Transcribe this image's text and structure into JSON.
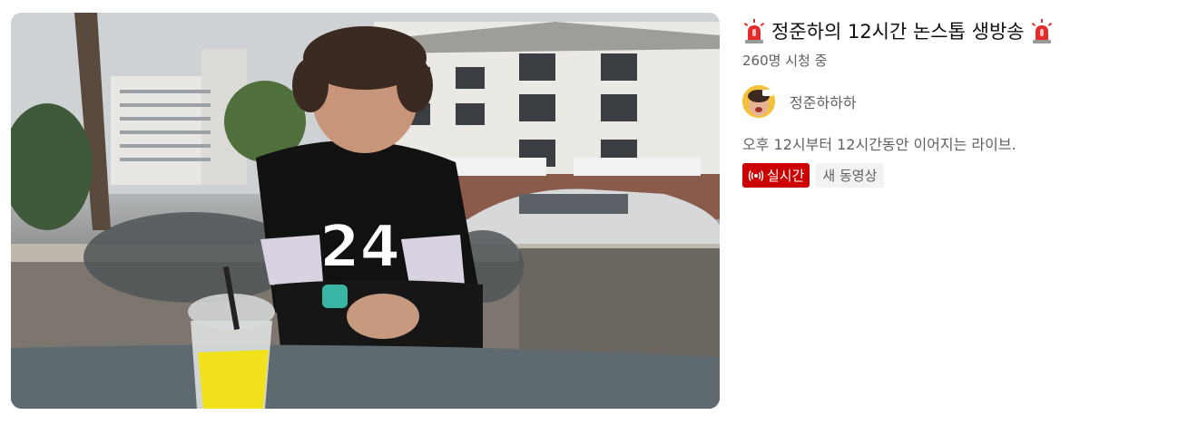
{
  "video": {
    "title": "정준하의 12시간 논스톱 생방송",
    "title_prefix_icon": "siren-icon",
    "title_suffix_icon": "siren-icon",
    "viewers": "260명 시청 중",
    "channel_name": "정준하하하",
    "description": "오후 12시부터 12시간동안 이어지는 라이브.",
    "badges": {
      "live": "실시간",
      "new": "새 동영상"
    }
  },
  "thumbnail": {
    "jersey_number": "24"
  },
  "colors": {
    "live_badge": "#cc0000",
    "secondary_text": "#606060",
    "primary_text": "#0f0f0f"
  }
}
